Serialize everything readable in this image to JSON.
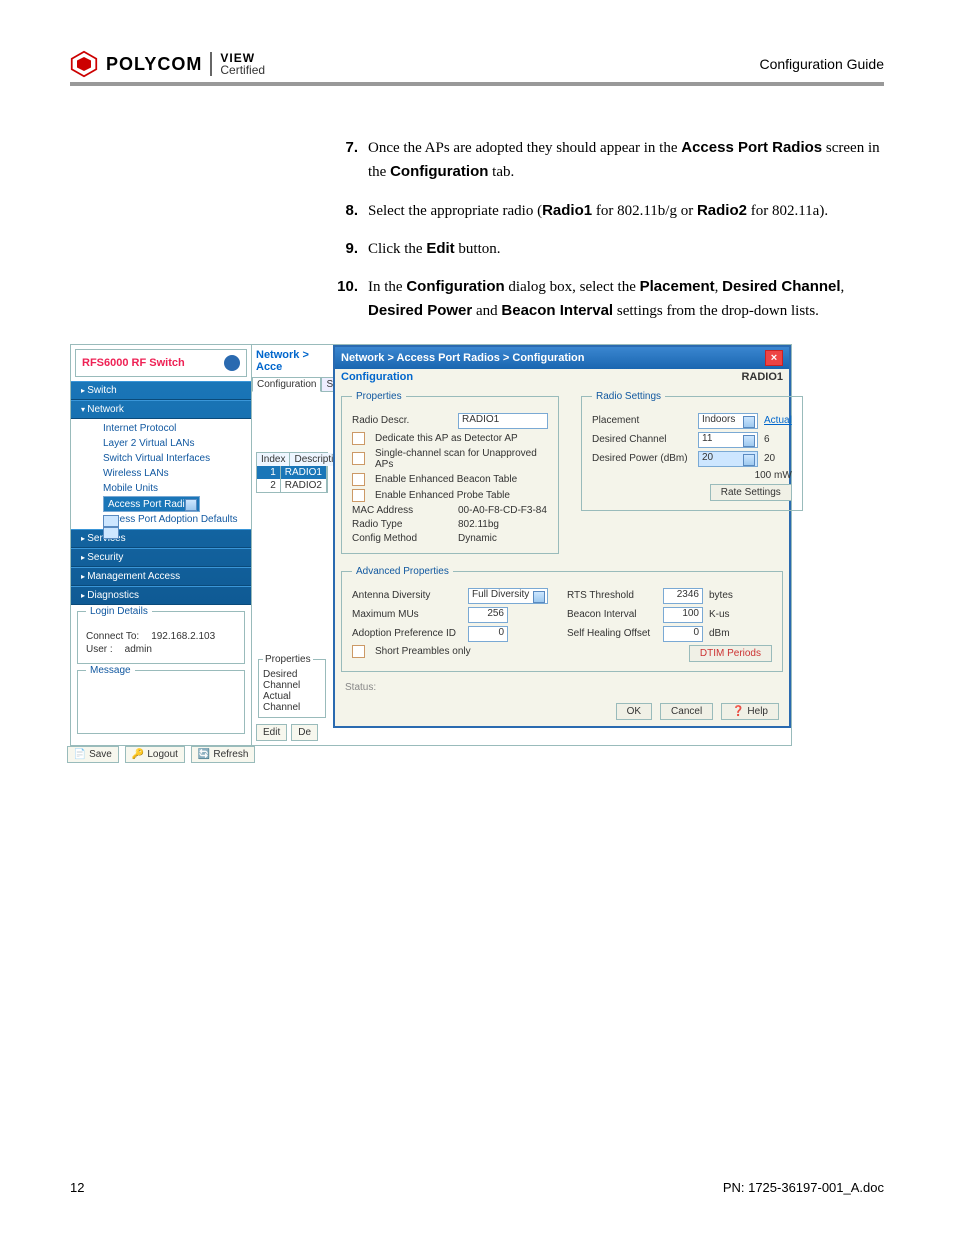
{
  "header": {
    "brand": "POLYCOM",
    "view": "VIEW",
    "certified": "Certified",
    "guide": "Configuration Guide"
  },
  "steps": [
    {
      "num": "7.",
      "parts": [
        "Once the APs are adopted they should appear in the ",
        "Access Port Radios",
        " screen in the ",
        "Configuration",
        " tab."
      ]
    },
    {
      "num": "8.",
      "parts": [
        "Select the appropriate radio (",
        "Radio1",
        " for 802.11b/g or ",
        "Radio2",
        " for 802.11a)."
      ]
    },
    {
      "num": "9.",
      "parts": [
        "Click the ",
        "Edit",
        " button."
      ]
    },
    {
      "num": "10.",
      "parts": [
        "In the ",
        "Configuration",
        " dialog box, select the ",
        "Placement",
        ", ",
        "Desired Channel",
        ", ",
        "Desired Power",
        " and ",
        "Beacon Interval",
        " settings from the drop-down lists."
      ]
    }
  ],
  "switch_title": "RFS6000 RF Switch",
  "nav": {
    "switch": "Switch",
    "network": "Network",
    "items": [
      "Internet Protocol",
      "Layer 2 Virtual LANs",
      "Switch Virtual Interfaces",
      "Wireless LANs",
      "Mobile Units",
      "Access Port Radios",
      "Access Port Adoption Defaults"
    ],
    "services": "Services",
    "security": "Security",
    "mgmt": "Management Access",
    "diag": "Diagnostics"
  },
  "login": {
    "title": "Login Details",
    "connect_lbl": "Connect To:",
    "connect_val": "192.168.2.103",
    "user_lbl": "User :",
    "user_val": "admin"
  },
  "message_title": "Message",
  "buttons": {
    "save": "Save",
    "logout": "Logout",
    "refresh": "Refresh",
    "edit": "Edit",
    "delete": "De"
  },
  "mid": {
    "crumb": "Network > Acce",
    "tabs": [
      "Configuration",
      "Statisti"
    ],
    "table_hdr": [
      "Index",
      "Descripti"
    ],
    "rows": [
      [
        "1",
        "RADIO1"
      ],
      [
        "2",
        "RADIO2"
      ]
    ],
    "props_title": "Properties",
    "desired_channel": "Desired Channel",
    "actual_channel": "Actual Channel"
  },
  "dialog": {
    "title": "Network > Access Port Radios > Configuration",
    "sub_left": "Configuration",
    "sub_right": "RADIO1",
    "props": {
      "legend": "Properties",
      "descr_lbl": "Radio Descr.",
      "descr_val": "RADIO1",
      "opt1": "Dedicate this AP as Detector AP",
      "opt2": "Single-channel scan for Unapproved APs",
      "opt3": "Enable Enhanced Beacon Table",
      "opt4": "Enable Enhanced Probe Table",
      "mac_lbl": "MAC Address",
      "mac_val": "00-A0-F8-CD-F3-84",
      "type_lbl": "Radio Type",
      "type_val": "802.11bg",
      "cfg_lbl": "Config Method",
      "cfg_val": "Dynamic"
    },
    "radio": {
      "legend": "Radio Settings",
      "placement_lbl": "Placement",
      "placement_val": "Indoors",
      "placement_link": "Actual",
      "channel_lbl": "Desired Channel",
      "channel_val": "11",
      "channel_actual": "6",
      "power_lbl": "Desired Power (dBm)",
      "power_val": "20",
      "power_actual": "20",
      "power_mw": "100 mW",
      "rate_btn": "Rate Settings"
    },
    "adv": {
      "legend": "Advanced Properties",
      "ant_lbl": "Antenna Diversity",
      "ant_val": "Full Diversity",
      "mu_lbl": "Maximum MUs",
      "mu_val": "256",
      "adopt_lbl": "Adoption Preference ID",
      "adopt_val": "0",
      "short_lbl": "Short Preambles only",
      "rts_lbl": "RTS Threshold",
      "rts_val": "2346",
      "rts_unit": "bytes",
      "beacon_lbl": "Beacon Interval",
      "beacon_val": "100",
      "beacon_unit": "K-us",
      "heal_lbl": "Self Healing Offset",
      "heal_val": "0",
      "heal_unit": "dBm",
      "dtim_btn": "DTIM Periods"
    },
    "status": "Status:",
    "ok": "OK",
    "cancel": "Cancel",
    "help": "Help"
  },
  "footer": {
    "page": "12",
    "pn": "PN: 1725-36197-001_A.doc"
  }
}
